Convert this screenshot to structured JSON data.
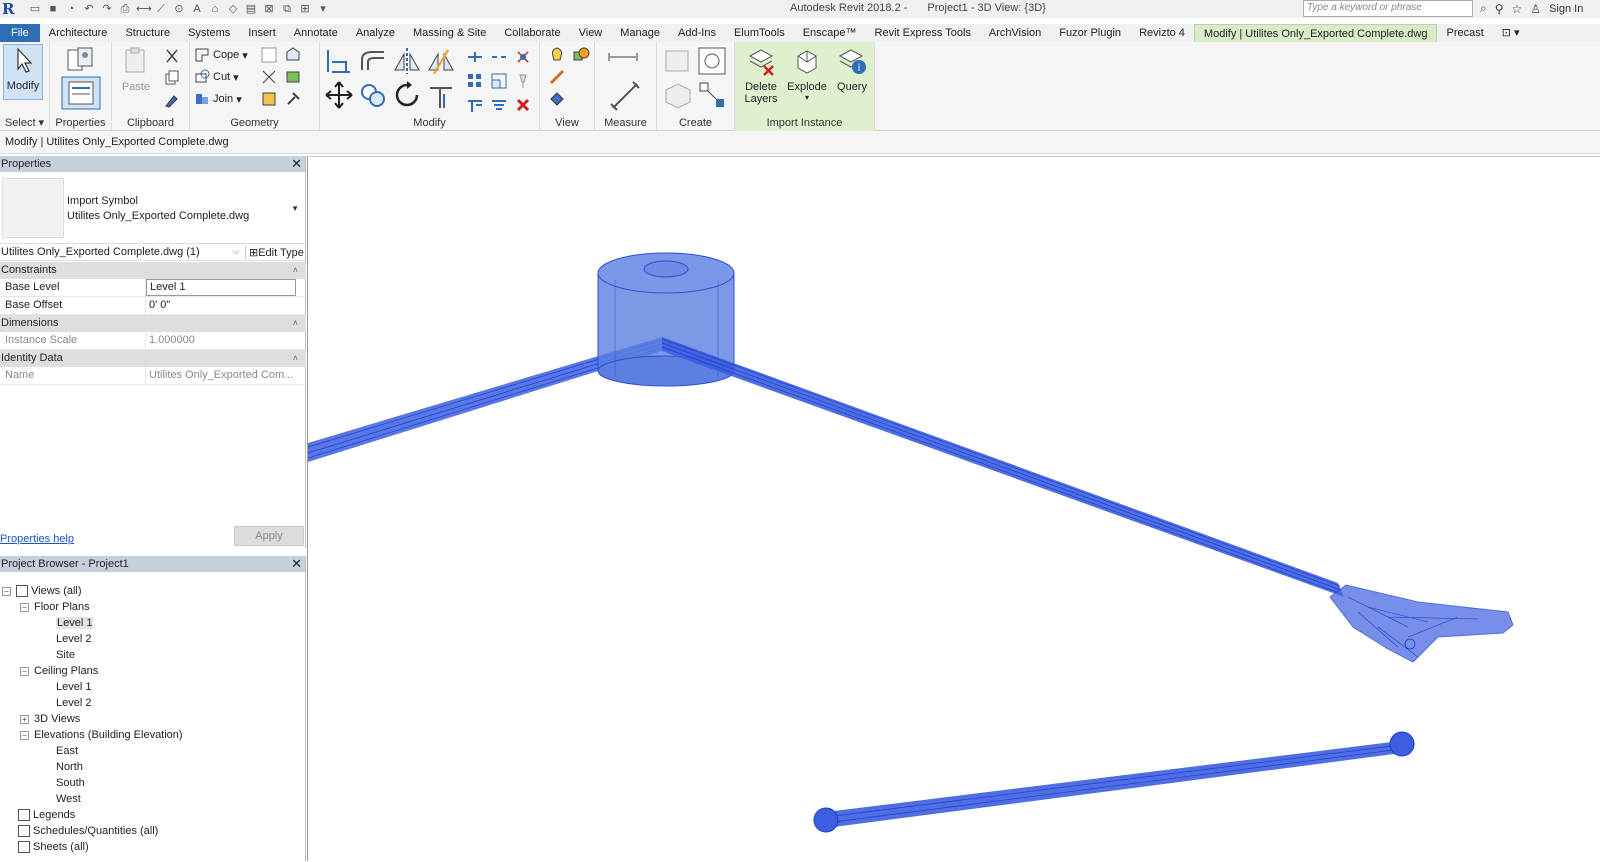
{
  "titlebar": {
    "app_title": "Autodesk Revit 2018.2 -",
    "view_title": "Project1 - 3D View: {3D}",
    "search_placeholder": "Type a keyword or phrase",
    "sign_in": "Sign In"
  },
  "tabs": [
    "File",
    "Architecture",
    "Structure",
    "Systems",
    "Insert",
    "Annotate",
    "Analyze",
    "Massing & Site",
    "Collaborate",
    "View",
    "Manage",
    "Add-Ins",
    "ElumTools",
    "Enscape™",
    "Revit Express Tools",
    "ArchVision",
    "Fuzor Plugin",
    "Revizto 4",
    "Modify | Utilites Only_Exported Complete.dwg",
    "Precast"
  ],
  "ribbon": {
    "modify_label": "Modify",
    "panels": {
      "select": "Select",
      "properties": "Properties",
      "clipboard": "Clipboard",
      "geometry": "Geometry",
      "modify": "Modify",
      "view": "View",
      "measure": "Measure",
      "create": "Create",
      "import_instance": "Import Instance"
    },
    "clipboard_paste": "Paste",
    "geometry_cope": "Cope",
    "geometry_cut": "Cut",
    "geometry_join": "Join",
    "import_delete_layers_1": "Delete",
    "import_delete_layers_2": "Layers",
    "import_explode": "Explode",
    "import_query": "Query"
  },
  "options_bar": {
    "context": "Modify | Utilites Only_Exported Complete.dwg"
  },
  "properties": {
    "header": "Properties",
    "type_line1": "Import Symbol",
    "type_line2": "Utilites Only_Exported Complete.dwg",
    "instance_selector": "Utilites Only_Exported Complete.dwg (1)",
    "edit_type": "Edit Type",
    "groups": {
      "constraints": "Constraints",
      "dimensions": "Dimensions",
      "identity": "Identity Data"
    },
    "rows": {
      "base_level_key": "Base Level",
      "base_level_val": "Level 1",
      "base_offset_key": "Base Offset",
      "base_offset_val": "0'  0\"",
      "instance_scale_key": "Instance Scale",
      "instance_scale_val": "1.000000",
      "name_key": "Name",
      "name_val": "Utilites Only_Exported Com..."
    },
    "help": "Properties help",
    "apply": "Apply"
  },
  "browser": {
    "header": "Project Browser - Project1",
    "views_all": "Views (all)",
    "floor_plans": "Floor Plans",
    "fp_level1": "Level 1",
    "fp_level2": "Level 2",
    "fp_site": "Site",
    "ceiling_plans": "Ceiling Plans",
    "cp_level1": "Level 1",
    "cp_level2": "Level 2",
    "views_3d": "3D Views",
    "elevations": "Elevations (Building Elevation)",
    "east": "East",
    "north": "North",
    "south": "South",
    "west": "West",
    "legends": "Legends",
    "schedules": "Schedules/Quantities (all)",
    "sheets": "Sheets (all)"
  },
  "colors": {
    "accent_blue": "#2f6db4",
    "context_green": "#dff0cf",
    "model_blue": "#1f4fe0",
    "model_fill": "#5d7fe0"
  }
}
